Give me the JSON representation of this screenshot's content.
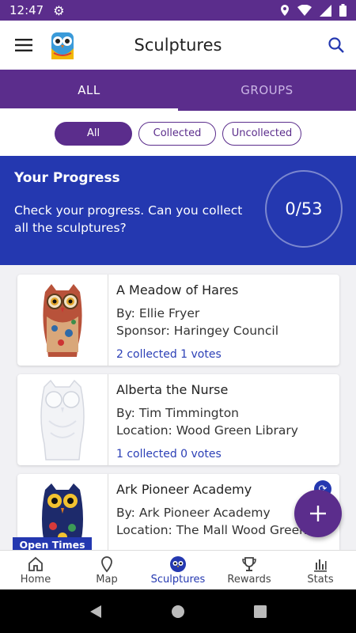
{
  "status": {
    "time": "12:47"
  },
  "app_bar": {
    "title": "Sculptures"
  },
  "tabs": [
    {
      "label": "ALL",
      "active": true
    },
    {
      "label": "GROUPS",
      "active": false
    }
  ],
  "filters": [
    {
      "label": "All",
      "active": true
    },
    {
      "label": "Collected",
      "active": false
    },
    {
      "label": "Uncollected",
      "active": false
    }
  ],
  "progress": {
    "title": "Your Progress",
    "text": "Check your progress. Can you collect all the sculptures?",
    "count": "0/53"
  },
  "cards": [
    {
      "title": "A Meadow of Hares",
      "line1": "By: Ellie Fryer",
      "line2": "Sponsor: Haringey Council",
      "stats": "2 collected 1 votes"
    },
    {
      "title": "Alberta the Nurse",
      "line1": "By: Tim Timmington",
      "line2": "Location: Wood Green Library",
      "stats": "1 collected 0 votes"
    },
    {
      "title": "Ark Pioneer Academy",
      "line1": "By: Ark Pioneer Academy",
      "line2": "Location: The Mall Wood Green"
    }
  ],
  "open_times": "Open Times",
  "fab": {
    "icon": "plus-icon"
  },
  "bottom_nav": [
    {
      "label": "Home",
      "icon": "home-icon"
    },
    {
      "label": "Map",
      "icon": "map-pin-icon"
    },
    {
      "label": "Sculptures",
      "icon": "owl-icon",
      "active": true
    },
    {
      "label": "Rewards",
      "icon": "trophy-icon"
    },
    {
      "label": "Stats",
      "icon": "bar-chart-icon"
    }
  ],
  "colors": {
    "primary": "#5b2d8c",
    "accent": "#2438b0"
  }
}
